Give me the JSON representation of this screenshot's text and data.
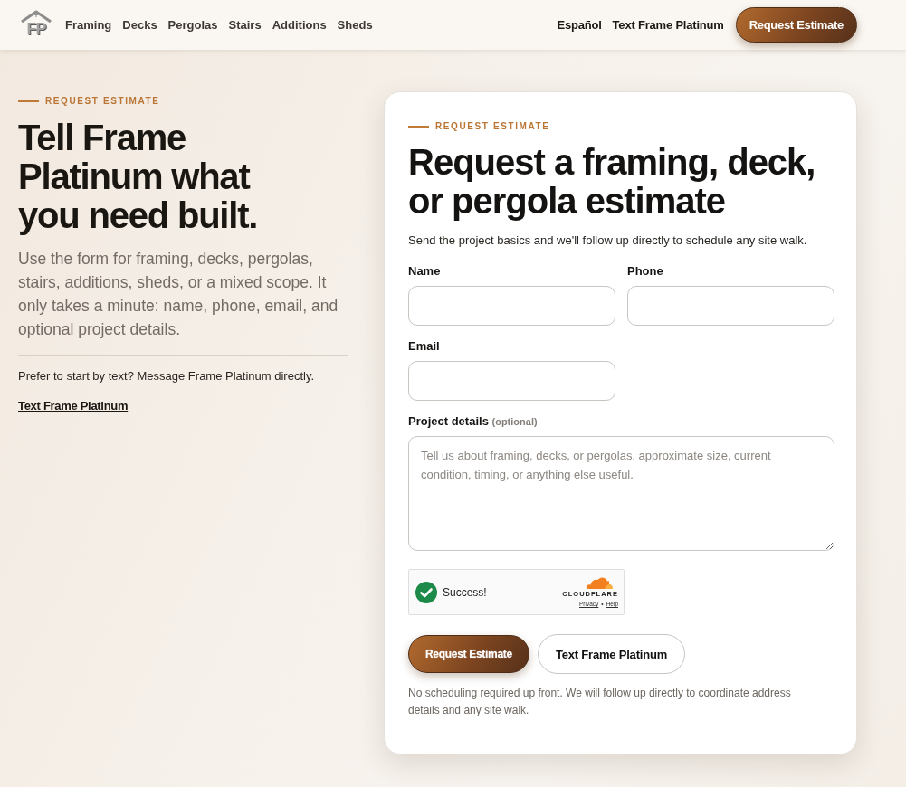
{
  "header": {
    "logo": {
      "monogram": "FP"
    },
    "nav": [
      "Framing",
      "Decks",
      "Pergolas",
      "Stairs",
      "Additions",
      "Sheds"
    ],
    "links": [
      "Español",
      "Text Frame Platinum"
    ],
    "cta": "Request Estimate"
  },
  "intro": {
    "eyebrow": "REQUEST ESTIMATE",
    "heading": "Tell Frame Platinum what you need built.",
    "body": "Use the form for framing, decks, pergolas, stairs, additions, sheds, or a mixed scope. It only takes a minute: name, phone, email, and optional project details.",
    "text_prompt": "Prefer to start by text? Message Frame Platinum directly.",
    "text_link": "Text Frame Platinum"
  },
  "form": {
    "eyebrow": "REQUEST ESTIMATE",
    "heading": "Request a framing, deck, or pergola estimate",
    "subtitle": "Send the project basics and we'll follow up directly to schedule any site walk.",
    "fields": [
      {
        "kind": "input",
        "label": "Name"
      },
      {
        "kind": "input",
        "label": "Phone"
      },
      {
        "kind": "input",
        "label": "Email"
      },
      {
        "kind": "textarea",
        "label": "Project details",
        "hint": "(optional)",
        "placeholder": "Tell us about framing, decks, or pergolas, approximate size, current condition, timing, or anything else useful."
      }
    ],
    "captcha": {
      "verified": true,
      "status": "Success!",
      "brand": "CLOUDFLARE",
      "links": [
        "Privacy",
        "Help"
      ],
      "separator": "•"
    },
    "buttons": [
      {
        "kind": "primary",
        "label": "Request Estimate"
      },
      {
        "kind": "secondary",
        "label": "Text Frame Platinum"
      }
    ],
    "note": "No scheduling required up front. We will follow up directly to coordinate address details and any site walk."
  }
}
